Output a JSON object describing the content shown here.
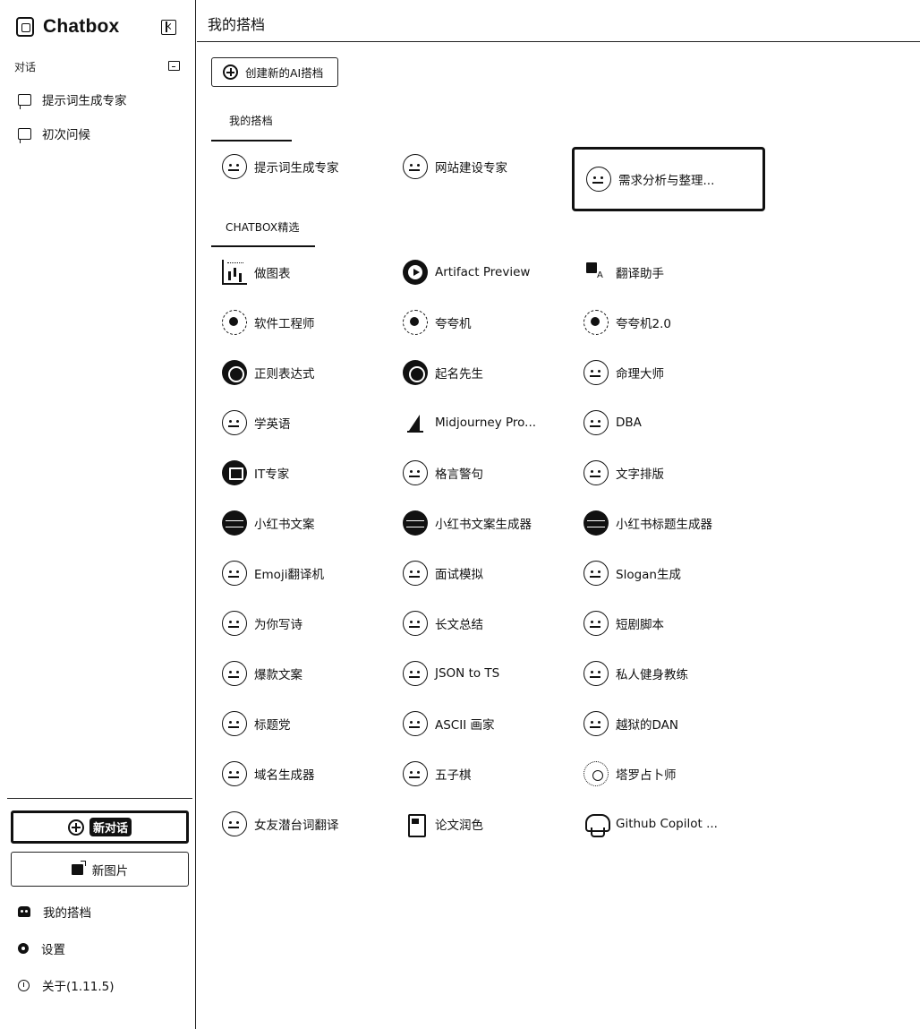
{
  "app": {
    "title": "Chatbox"
  },
  "sidebar": {
    "section_label": "对话",
    "conversations": [
      {
        "label": "提示词生成专家"
      },
      {
        "label": "初次问候"
      }
    ],
    "new_chat_label": "新对话",
    "new_image_label": "新图片",
    "nav": [
      {
        "label": "我的搭档",
        "icon": "bot-icon"
      },
      {
        "label": "设置",
        "icon": "gear-icon"
      },
      {
        "label": "关于(1.11.5)",
        "icon": "info-icon"
      }
    ]
  },
  "main": {
    "title": "我的搭档",
    "create_button": "创建新的AI搭档",
    "my_section": {
      "title": "我的搭档",
      "agents": [
        {
          "label": "提示词生成专家",
          "icon": "face-icon"
        },
        {
          "label": "网站建设专家",
          "icon": "face-icon"
        },
        {
          "label": "需求分析与整理...",
          "icon": "face-icon",
          "selected": true
        }
      ]
    },
    "featured_section": {
      "title": "CHATBOX精选",
      "agents": [
        {
          "label": "做图表",
          "icon": "chart-icon"
        },
        {
          "label": "Artifact Preview",
          "icon": "play-icon"
        },
        {
          "label": "翻译助手",
          "icon": "translate-icon"
        },
        {
          "label": "软件工程师",
          "icon": "engineer-icon"
        },
        {
          "label": "夸夸机",
          "icon": "sketch-avatar-icon"
        },
        {
          "label": "夸夸机2.0",
          "icon": "sketch-avatar-icon"
        },
        {
          "label": "正则表达式",
          "icon": "regex-icon"
        },
        {
          "label": "起名先生",
          "icon": "seal-icon"
        },
        {
          "label": "命理大师",
          "icon": "face-icon"
        },
        {
          "label": "学英语",
          "icon": "face-icon"
        },
        {
          "label": "Midjourney Pro...",
          "icon": "sailboat-icon"
        },
        {
          "label": "DBA",
          "icon": "face-icon"
        },
        {
          "label": "IT专家",
          "icon": "monitor-icon"
        },
        {
          "label": "格言警句",
          "icon": "face-icon"
        },
        {
          "label": "文字排版",
          "icon": "face-icon"
        },
        {
          "label": "小红书文案",
          "icon": "xiaohongshu-icon"
        },
        {
          "label": "小红书文案生成器",
          "icon": "xiaohongshu-icon"
        },
        {
          "label": "小红书标题生成器",
          "icon": "xiaohongshu-icon"
        },
        {
          "label": "Emoji翻译机",
          "icon": "face-icon"
        },
        {
          "label": "面试模拟",
          "icon": "face-icon"
        },
        {
          "label": "Slogan生成",
          "icon": "face-icon"
        },
        {
          "label": "为你写诗",
          "icon": "face-icon"
        },
        {
          "label": "长文总结",
          "icon": "face-icon"
        },
        {
          "label": "短剧脚本",
          "icon": "face-icon"
        },
        {
          "label": "爆款文案",
          "icon": "face-icon"
        },
        {
          "label": "JSON to TS",
          "icon": "face-icon"
        },
        {
          "label": "私人健身教练",
          "icon": "face-icon"
        },
        {
          "label": "标题党",
          "icon": "face-icon"
        },
        {
          "label": "ASCII 画家",
          "icon": "face-icon"
        },
        {
          "label": "越狱的DAN",
          "icon": "face-icon"
        },
        {
          "label": "域名生成器",
          "icon": "face-icon"
        },
        {
          "label": "五子棋",
          "icon": "face-icon"
        },
        {
          "label": "塔罗占卜师",
          "icon": "tarot-icon"
        },
        {
          "label": "女友潜台词翻译",
          "icon": "face-icon"
        },
        {
          "label": "论文润色",
          "icon": "book-icon"
        },
        {
          "label": "Github Copilot ...",
          "icon": "copilot-icon"
        }
      ]
    }
  }
}
